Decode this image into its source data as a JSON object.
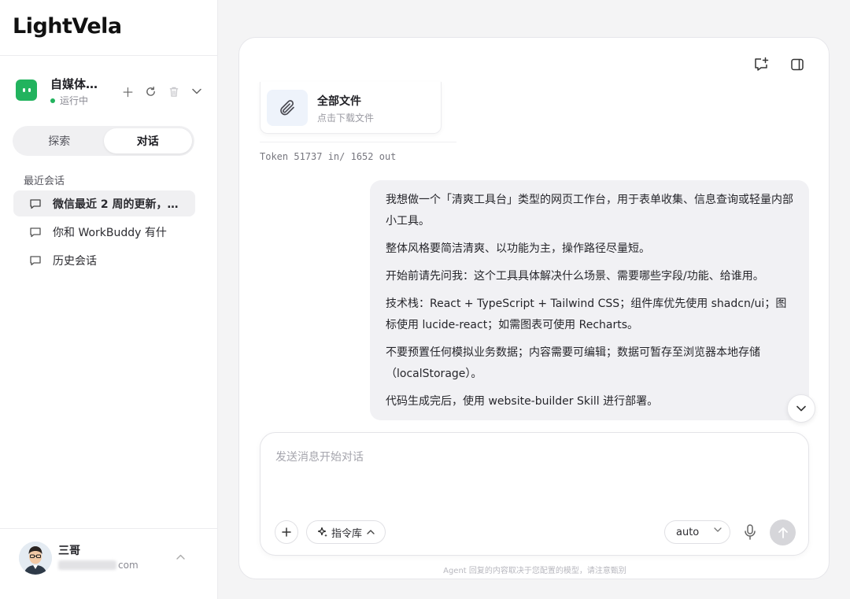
{
  "app": {
    "logo": "LightVela"
  },
  "agent": {
    "name": "自媒体…",
    "status": "运行中",
    "actions": [
      "plus-icon",
      "refresh-icon",
      "trash-icon",
      "chevron-down-icon"
    ]
  },
  "tabs": {
    "explore": "探索",
    "chat": "对话",
    "active": "chat"
  },
  "recent": {
    "label": "最近会话",
    "items": [
      {
        "title": "微信最近 2 周的更新，…",
        "active": true
      },
      {
        "title": "你和 WorkBuddy 有什",
        "active": false
      },
      {
        "title": "历史会话",
        "active": false
      }
    ]
  },
  "user": {
    "name": "三哥",
    "email_suffix": "com"
  },
  "header_icons": [
    "new-chat-icon",
    "sidebar-toggle-icon"
  ],
  "file_card": {
    "title": "全部文件",
    "subtitle": "点击下载文件"
  },
  "token": "Token 51737 in/ 1652 out",
  "message": {
    "paragraphs": [
      "我想做一个「清爽工具台」类型的网页工作台，用于表单收集、信息查询或轻量内部小工具。",
      "整体风格要简洁清爽、以功能为主，操作路径尽量短。",
      "开始前请先问我：这个工具具体解决什么场景、需要哪些字段/功能、给谁用。",
      "技术栈：React + TypeScript + Tailwind CSS；组件库优先使用 shadcn/ui；图标使用 lucide-react；如需图表可使用 Recharts。",
      "不要预置任何模拟业务数据；内容需要可编辑；数据可暂存至浏览器本地存储（localStorage）。",
      "代码生成完后，使用 website-builder Skill 进行部署。"
    ]
  },
  "composer": {
    "placeholder": "发送消息开始对话",
    "library_label": "指令库",
    "model": "auto"
  },
  "disclaimer": "Agent 回复的内容取决于您配置的模型，请注意甄别",
  "colors": {
    "accent": "#22b35e",
    "bubble": "#f1f1f4",
    "send_disabled": "#d6d6da"
  }
}
